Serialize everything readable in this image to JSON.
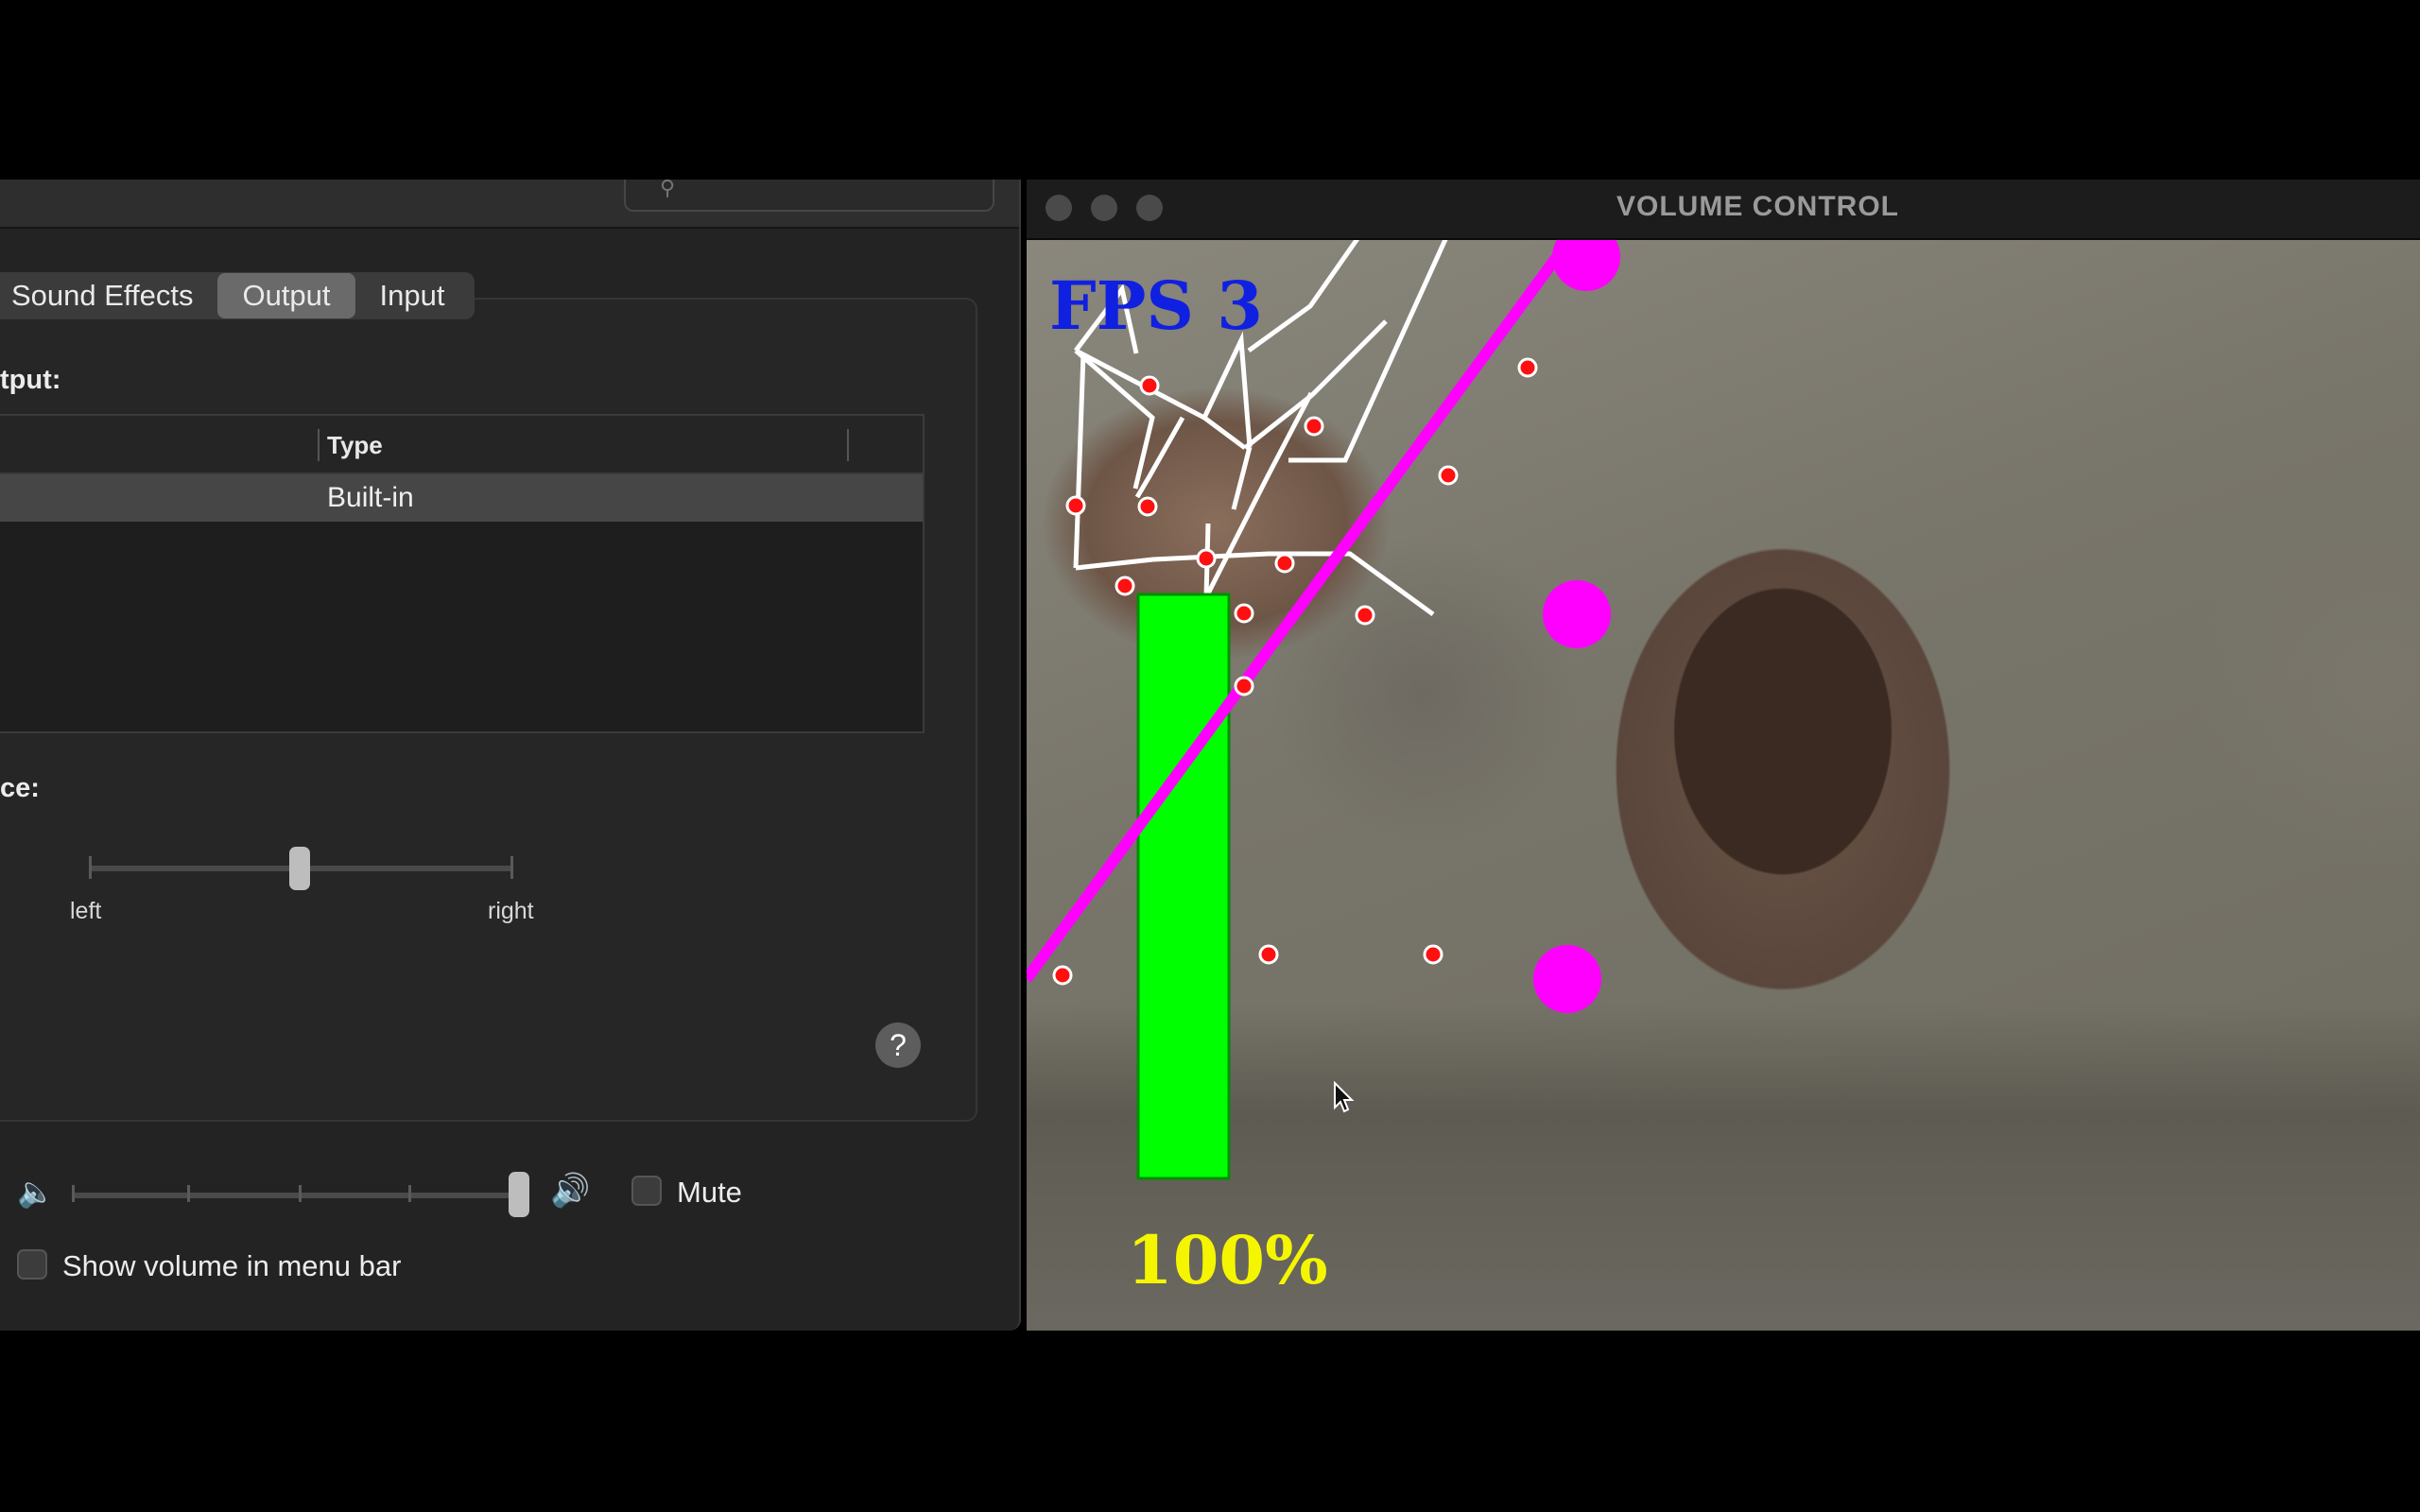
{
  "sound_prefs": {
    "tabs": [
      {
        "label": "Sound Effects",
        "active": false
      },
      {
        "label": "Output",
        "active": true
      },
      {
        "label": "Input",
        "active": false
      }
    ],
    "output_heading": "tput:",
    "table": {
      "columns": [
        "Type"
      ],
      "rows": [
        {
          "type": "Built-in",
          "selected": true
        }
      ]
    },
    "balance": {
      "label": "ce:",
      "left_label": "left",
      "right_label": "right",
      "position": 0.5
    },
    "help_label": "?",
    "output_volume": {
      "level": 1.0,
      "low_icon": "speaker-low-icon",
      "high_icon": "speaker-high-icon"
    },
    "mute_label": "Mute",
    "mute_checked": false,
    "menubar_label": "Show volume in menu bar",
    "menubar_checked": false
  },
  "volume_window": {
    "title": "VOLUME CONTROL",
    "fps_text": "FPS 3",
    "volume_text": "100%",
    "volume_level": 1.0,
    "colors": {
      "fps": "#1020e0",
      "volume_text": "#f5f500",
      "volume_bar": "#00ff00",
      "landmark_line": "#ffffff",
      "landmark_point": "#ff1010",
      "pinch": "#ff00ff"
    }
  }
}
